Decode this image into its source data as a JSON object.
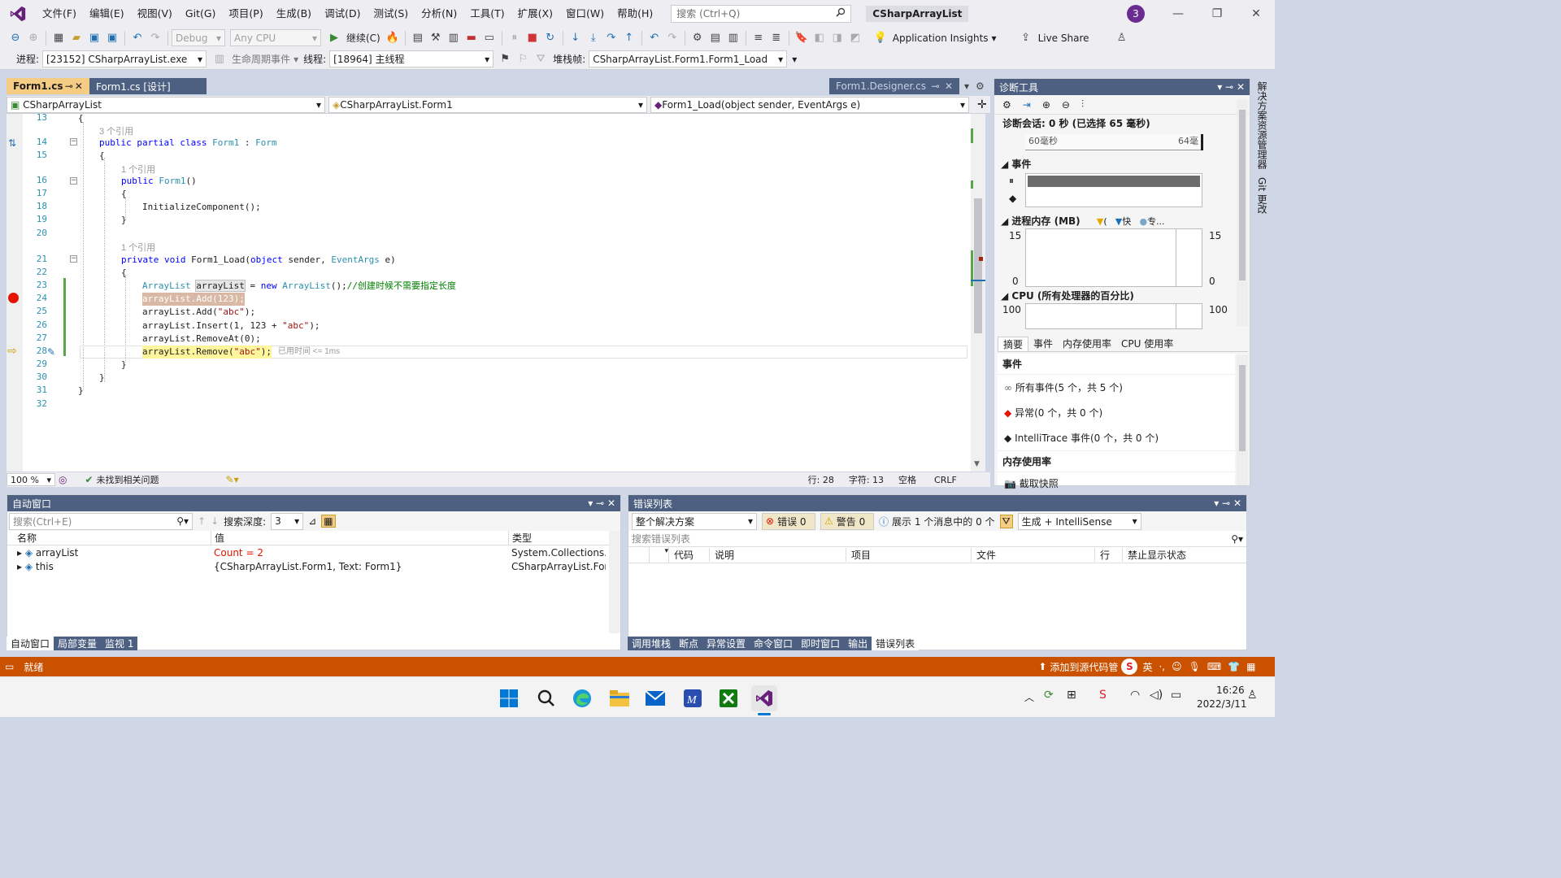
{
  "menubar": {
    "items": [
      "文件(F)",
      "编辑(E)",
      "视图(V)",
      "Git(G)",
      "项目(P)",
      "生成(B)",
      "调试(D)",
      "测试(S)",
      "分析(N)",
      "工具(T)",
      "扩展(X)",
      "窗口(W)",
      "帮助(H)"
    ],
    "search_placeholder": "搜索 (Ctrl+Q)",
    "solution_name": "CSharpArrayList",
    "account_badge": "3"
  },
  "toolbar1": {
    "config": "Debug",
    "platform": "Any CPU",
    "continue_label": "继续(C)",
    "app_insights": "Application Insights",
    "live_share": "Live Share"
  },
  "toolbar2": {
    "process_label": "进程:",
    "process_value": "[23152] CSharpArrayList.exe",
    "lifecycle_label": "生命周期事件",
    "thread_label": "线程:",
    "thread_value": "[18964] 主线程",
    "stackframe_label": "堆栈帧:",
    "stackframe_value": "CSharpArrayList.Form1.Form1_Load"
  },
  "editor": {
    "tabs": [
      {
        "label": "Form1.cs",
        "active": true
      },
      {
        "label": "Form1.cs [设计]",
        "active": false
      }
    ],
    "right_tab": "Form1.Designer.cs",
    "nav_project": "CSharpArrayList",
    "nav_class": "CSharpArrayList.Form1",
    "nav_member": "Form1_Load(object sender, EventArgs e)",
    "refs": {
      "r13": "3 个引用",
      "r16": "1 个引用",
      "r21": "1 个引用"
    },
    "line_numbers": [
      "13",
      "14",
      "15",
      "16",
      "17",
      "18",
      "19",
      "20",
      "21",
      "22",
      "23",
      "24",
      "25",
      "26",
      "27",
      "28",
      "29",
      "30",
      "31",
      "32"
    ],
    "elapsed_hint": "已用时间 <= 1ms",
    "zoom": "100 %",
    "issues": "未找到相关问题",
    "line": "行: 28",
    "col": "字符: 13",
    "spaces": "空格",
    "eol": "CRLF"
  },
  "code": {
    "l13": "{",
    "l14_kw1": "public",
    "l14_kw2": "partial",
    "l14_kw3": "class",
    "l14_name": "Form1",
    "l14_colon": " : ",
    "l14_base": "Form",
    "l15": "{",
    "l16_kw": "public",
    "l16_name": "Form1",
    "l16_rest": "()",
    "l17": "{",
    "l18": "InitializeComponent();",
    "l19": "}",
    "l21_kw1": "private",
    "l21_kw2": "void",
    "l21_name": " Form1_Load(",
    "l21_kw3": "object",
    "l21_p1": " sender, ",
    "l21_ty": "EventArgs",
    "l21_p2": " e)",
    "l22": "{",
    "l23_ty": "ArrayList",
    "l23_var": "arrayList",
    "l23_eq": " = ",
    "l23_kw": "new",
    "l23_ty2": "ArrayList",
    "l23_end": "();",
    "l23_cm": "//创建时候不需要指定长度",
    "l24": "arrayList.Add(123);",
    "l25_a": "arrayList.Add(",
    "l25_s": "\"abc\"",
    "l25_b": ");",
    "l26_a": "arrayList.Insert(1, 123 + ",
    "l26_s": "\"abc\"",
    "l26_b": ");",
    "l27": "arrayList.RemoveAt(0);",
    "l28_a": "arrayList.Remove(",
    "l28_s": "\"abc\"",
    "l28_b": ");",
    "l29": "}",
    "l30": "}",
    "l31": "}"
  },
  "diag": {
    "title": "诊断工具",
    "session": "诊断会话: 0 秒 (已选择 65 毫秒)",
    "ruler_a": "60毫秒",
    "ruler_b": "64毫",
    "events_heading": "事件",
    "mem_heading": "进程内存 (MB)",
    "mem_legend": [
      "(",
      "快",
      "专..."
    ],
    "mem_max": "15",
    "mem_min": "0",
    "cpu_heading": "CPU (所有处理器的百分比)",
    "cpu_max": "100",
    "tabs": [
      "摘要",
      "事件",
      "内存使用率",
      "CPU 使用率"
    ],
    "events_section": "事件",
    "all_events": "所有事件(5 个，共 5 个)",
    "exceptions": "异常(0 个，共 0 个)",
    "intellitrace": "IntelliTrace 事件(0 个，共 0 个)",
    "memory_section": "内存使用率",
    "snapshot": "截取快照"
  },
  "right_strip": [
    "解决方案资源管理器",
    "Git 更改"
  ],
  "autos": {
    "title": "自动窗口",
    "search_placeholder": "搜索(Ctrl+E)",
    "depth_label": "搜索深度:",
    "depth_value": "3",
    "columns": [
      "名称",
      "值",
      "类型"
    ],
    "rows": [
      {
        "name": "arrayList",
        "value": "Count = 2",
        "type": "System.Collections...."
      },
      {
        "name": "this",
        "value": "{CSharpArrayList.Form1, Text: Form1}",
        "type": "CSharpArrayList.For..."
      }
    ],
    "tabs": [
      "自动窗口",
      "局部变量",
      "监视 1"
    ]
  },
  "errors": {
    "title": "错误列表",
    "scope": "整个解决方案",
    "errors_btn": "错误 0",
    "warnings_btn": "警告 0",
    "messages_btn": "展示 1 个消息中的 0 个",
    "build_filter": "生成 + IntelliSense",
    "search_placeholder": "搜索错误列表",
    "columns": [
      "代码",
      "说明",
      "项目",
      "文件",
      "行",
      "禁止显示状态"
    ],
    "tabs": [
      "调用堆栈",
      "断点",
      "异常设置",
      "命令窗口",
      "即时窗口",
      "输出",
      "错误列表"
    ]
  },
  "status": {
    "ready": "就绪",
    "source_control": "添加到源代码管",
    "ime": "英"
  },
  "taskbar": {
    "time": "16:26",
    "date": "2022/3/11"
  },
  "colors": {
    "accent_purple": "#68217a",
    "status_orange": "#ca5100",
    "tab_gold": "#f5cc84"
  }
}
